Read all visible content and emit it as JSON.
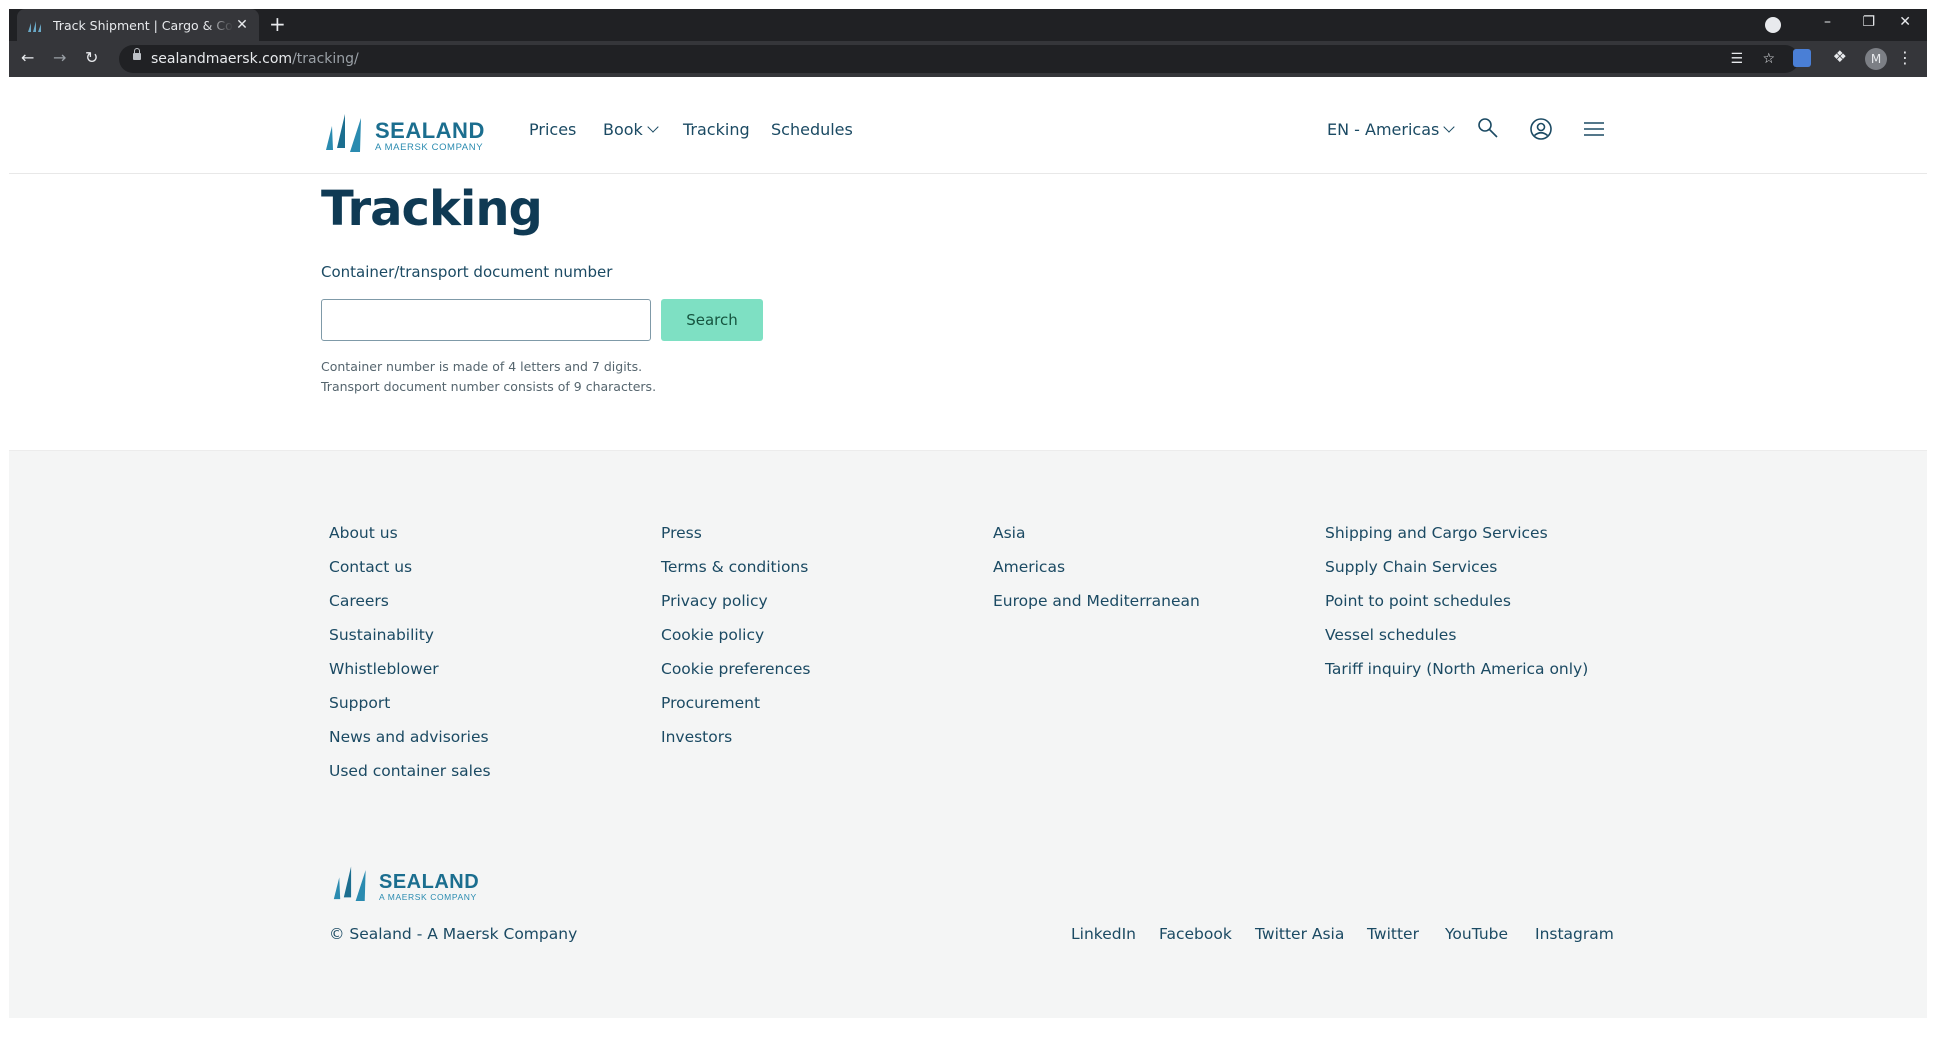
{
  "browser": {
    "tab_title": "Track Shipment | Cargo & Container Tracking | Sealand",
    "tab_close": "✕",
    "new_tab": "+",
    "url_host": "sealandmaersk.com",
    "url_path": "/tracking/",
    "profile_initial": "M",
    "window_controls": {
      "minimize": "–",
      "restore": "❐",
      "close": "✕"
    }
  },
  "header": {
    "logo": {
      "word": "SEALAND",
      "sub": "A MAERSK COMPANY"
    },
    "nav": [
      {
        "label": "Prices"
      },
      {
        "label": "Book"
      },
      {
        "label": "Tracking"
      },
      {
        "label": "Schedules"
      }
    ],
    "locale": "EN - Americas",
    "icons": [
      "search-icon",
      "account-icon",
      "menu-icon"
    ]
  },
  "main": {
    "title": "Tracking",
    "field_label": "Container/transport document number",
    "input_value": "",
    "search_label": "Search",
    "hint_1": "Container number is made of 4 letters and 7 digits.",
    "hint_2": "Transport document number consists of 9 characters."
  },
  "footer": {
    "col1": [
      "About us",
      "Contact us",
      "Careers",
      "Sustainability",
      "Whistleblower",
      "Support",
      "News and advisories",
      "Used container sales"
    ],
    "col2": [
      "Press",
      "Terms & conditions",
      "Privacy policy",
      "Cookie policy",
      "Cookie preferences",
      "Procurement",
      "Investors"
    ],
    "col3": [
      "Asia",
      "Americas",
      "Europe and Mediterranean"
    ],
    "col4": [
      "Shipping and Cargo Services",
      "Supply Chain Services",
      "Point to point schedules",
      "Vessel schedules",
      "Tariff inquiry (North America only)"
    ],
    "logo": {
      "word": "SEALAND",
      "sub": "A MAERSK COMPANY"
    },
    "copyright": "© Sealand - A Maersk Company",
    "social": [
      "LinkedIn",
      "Facebook",
      "Twitter Asia",
      "Twitter",
      "YouTube",
      "Instagram"
    ]
  },
  "colors": {
    "brand_navy": "#0f3a54",
    "brand_blue": "#1b6e8f",
    "search_button": "#7ee0c3",
    "footer_bg": "#f4f5f5"
  }
}
